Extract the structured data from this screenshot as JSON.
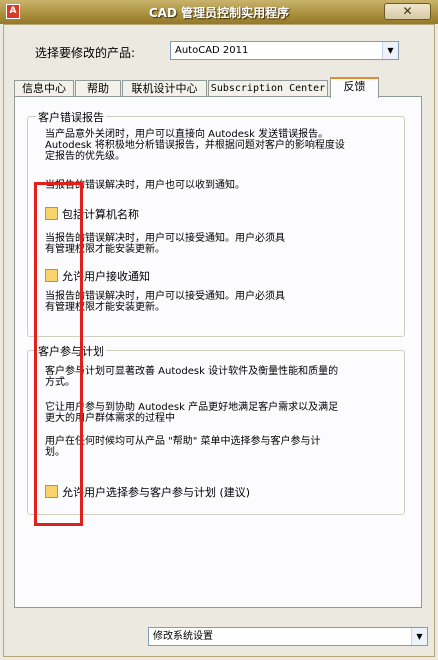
{
  "window": {
    "title": "CAD 管理员控制实用程序",
    "app_icon_glyph": "A",
    "close_glyph": "✕"
  },
  "product": {
    "label": "选择要修改的产品:",
    "value": "AutoCAD 2011",
    "arrow": "▼"
  },
  "tabs": [
    {
      "label": "信息中心"
    },
    {
      "label": "帮助"
    },
    {
      "label": "联机设计中心"
    },
    {
      "label": "Subscription Center"
    },
    {
      "label": "反馈",
      "active": true
    }
  ],
  "error_report": {
    "title": "客户错误报告",
    "intro": "当产品意外关闭时，用户可以直接向 Autodesk 发送错误报告。\nAutodesk 将积极地分析错误报告，并根据问题对客户的影响程度设\n定报告的优先级。",
    "notify": "当报告的错误解决时，用户也可以收到通知。",
    "cb_computer_name": "包括计算机名称",
    "cb_computer_name_desc": "当报告的错误解决时，用户可以接受通知。用户必须具\n有管理权限才能安装更新。",
    "cb_notify": "允许用户接收通知",
    "cb_notify_desc": "当报告的错误解决时，用户可以接受通知。用户必须具\n有管理权限才能安装更新。"
  },
  "cip": {
    "title": "客户参与计划",
    "p1": "客户参与计划可显著改善 Autodesk 设计软件及衡量性能和质量的\n方式。",
    "p2": "它让用户参与到协助 Autodesk 产品更好地满足客户需求以及满足\n更大的用户群体需求的过程中",
    "p3": "用户在任何时候均可从产品 \"帮助\" 菜单中选择参与客户参与计\n划。",
    "cb_label": "允许用户选择参与客户参与计划 (建议)"
  },
  "footer": {
    "value": "修改系统设置",
    "arrow": "▼"
  },
  "colors": {
    "checkbox_fill": "#f8d36c",
    "annotation_red": "#e0201c",
    "titlebar": "#a98f3c",
    "tab_accent": "#e68b2c"
  }
}
